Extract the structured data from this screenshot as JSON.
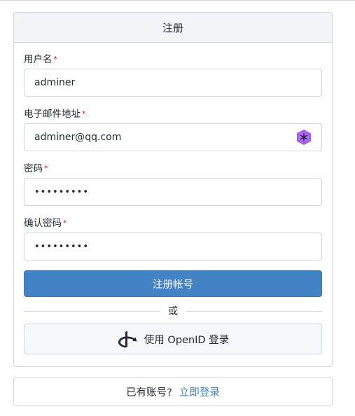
{
  "header": {
    "title": "注册"
  },
  "form": {
    "username": {
      "label": "用户名",
      "required_mark": "*",
      "value": "adminer"
    },
    "email": {
      "label": "电子邮件地址",
      "required_mark": "*",
      "value": "adminer@qq.com",
      "extension_icon": "password-manager-icon"
    },
    "password": {
      "label": "密码",
      "required_mark": "*",
      "value": "•••••••••"
    },
    "confirm_password": {
      "label": "确认密码",
      "required_mark": "*",
      "value": "•••••••••"
    },
    "submit_label": "注册帐号",
    "divider_text": "或",
    "openid_label": "使用 OpenID 登录",
    "openid_icon": "openid-icon"
  },
  "footer": {
    "prompt": "已有账号?",
    "login_link": "立即登录"
  },
  "colors": {
    "primary": "#4183c4",
    "required": "#cf222e",
    "border": "#d0d7de",
    "extension_icon": "#a855f7"
  }
}
